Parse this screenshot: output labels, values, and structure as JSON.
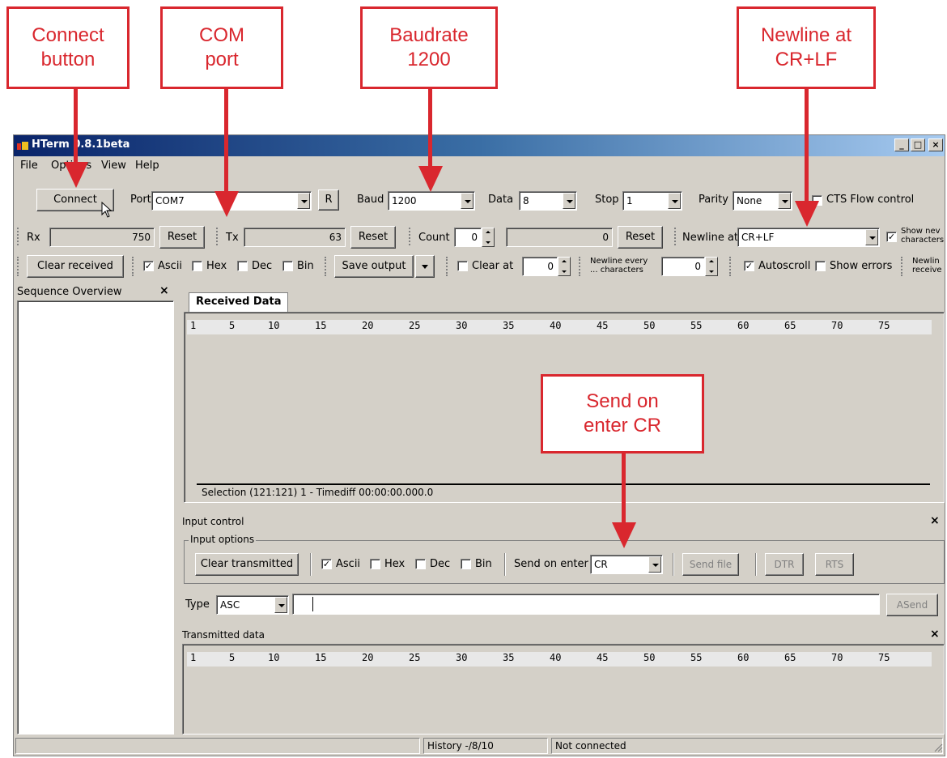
{
  "callouts": {
    "connect": "Connect button",
    "com": "COM port",
    "baud": "Baudrate 1200",
    "newline": "Newline at CR+LF",
    "send": "Send on enter CR"
  },
  "window": {
    "title": "HTerm 0.8.1beta"
  },
  "menu": [
    "File",
    "Options",
    "View",
    "Help"
  ],
  "toolbar1": {
    "connect": "Connect",
    "port_label": "Port",
    "port_value": "COM7",
    "r_button": "R",
    "baud_label": "Baud",
    "baud_value": "1200",
    "data_label": "Data",
    "data_value": "8",
    "stop_label": "Stop",
    "stop_value": "1",
    "parity_label": "Parity",
    "parity_value": "None",
    "cts_label": "CTS Flow control"
  },
  "toolbar2": {
    "rx_label": "Rx",
    "rx_value": "750",
    "rx_reset": "Reset",
    "tx_label": "Tx",
    "tx_value": "63",
    "tx_reset": "Reset",
    "count_label": "Count",
    "count_value": "0",
    "count_total": "0",
    "count_reset": "Reset",
    "newline_label": "Newline at",
    "newline_value": "CR+LF",
    "show_newline_1": "Show nev",
    "show_newline_2": "characters"
  },
  "toolbar3": {
    "clear_received": "Clear received",
    "ascii": "Ascii",
    "hex": "Hex",
    "dec": "Dec",
    "bin": "Bin",
    "save_output": "Save output",
    "clear_at": "Clear at",
    "clear_at_value": "0",
    "newline_every_1": "Newline every",
    "newline_every_2": "... characters",
    "newline_every_value": "0",
    "autoscroll": "Autoscroll",
    "show_errors": "Show errors",
    "newline_recv_1": "Newlin",
    "newline_recv_2": "receive"
  },
  "sequence": {
    "title": "Sequence Overview"
  },
  "received": {
    "tab": "Received Data",
    "ruler": [
      "1",
      "5",
      "10",
      "15",
      "20",
      "25",
      "30",
      "35",
      "40",
      "45",
      "50",
      "55",
      "60",
      "65",
      "70",
      "75"
    ],
    "selection": "Selection (121:121) 1  -  Timediff 00:00:00.000.0"
  },
  "input_control": {
    "title": "Input control",
    "options_label": "Input options",
    "clear_transmitted": "Clear transmitted",
    "ascii": "Ascii",
    "hex": "Hex",
    "dec": "Dec",
    "bin": "Bin",
    "send_on_enter_label": "Send on enter",
    "send_on_enter_value": "CR",
    "send_file": "Send file",
    "dtr": "DTR",
    "rts": "RTS",
    "type_label": "Type",
    "type_value": "ASC",
    "asend": "ASend"
  },
  "transmitted": {
    "title": "Transmitted data",
    "ruler": [
      "1",
      "5",
      "10",
      "15",
      "20",
      "25",
      "30",
      "35",
      "40",
      "45",
      "50",
      "55",
      "60",
      "65",
      "70",
      "75"
    ]
  },
  "statusbar": {
    "history": "History -/8/10",
    "connection": "Not connected"
  },
  "colors": {
    "callout": "#d9272e",
    "title_start": "#0a246a",
    "title_end": "#a6caf0",
    "face": "#d4d0c8"
  }
}
